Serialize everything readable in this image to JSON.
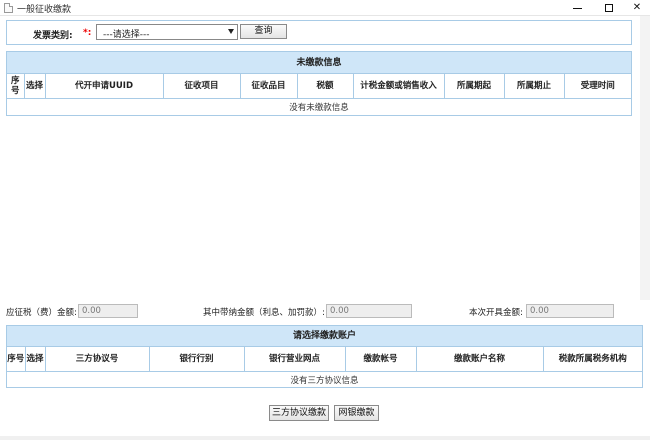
{
  "window": {
    "title": "一般征收缴款",
    "icon": "document-icon",
    "controls": {
      "minimize": "minimize-icon",
      "maximize": "maximize-icon",
      "close": "✕"
    }
  },
  "query": {
    "label": "发票类别:",
    "required_mark": "*:",
    "select_value": "---请选择---",
    "button": "查询"
  },
  "unpaid_table": {
    "title": "未缴款信息",
    "columns": [
      "序号",
      "选择",
      "代开申请UUID",
      "征收项目",
      "征收品目",
      "税额",
      "计税金额或销售收入",
      "所属期起",
      "所属期止",
      "受理时间"
    ],
    "empty_message": "没有未缴款信息"
  },
  "amounts": {
    "tax_label": "应征税（费）金额:",
    "tax_value": "0.00",
    "late_fee_label": "其中带纳金额（利息、加罚款）:",
    "late_fee_value": "0.00",
    "invoice_label": "本次开具金额:",
    "invoice_value": "0.00"
  },
  "account_table": {
    "title": "请选择缴款账户",
    "columns": [
      "序号",
      "选择",
      "三方协议号",
      "银行行别",
      "银行营业网点",
      "缴款帐号",
      "缴款账户名称",
      "税款所属税务机构"
    ],
    "empty_message": "没有三方协议信息"
  },
  "actions": {
    "three_party": "三方协议缴款",
    "online": "网银缴款"
  }
}
